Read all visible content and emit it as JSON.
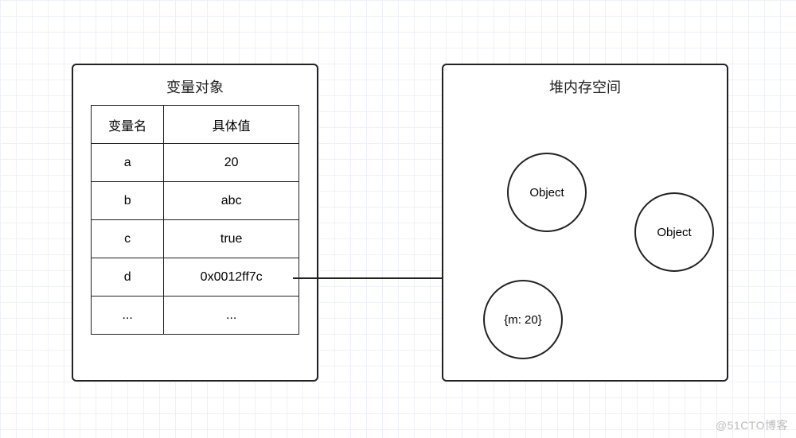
{
  "left_panel": {
    "title": "变量对象",
    "header": {
      "name": "变量名",
      "value": "具体值"
    },
    "rows": [
      {
        "name": "a",
        "value": "20"
      },
      {
        "name": "b",
        "value": "abc"
      },
      {
        "name": "c",
        "value": "true"
      },
      {
        "name": "d",
        "value": "0x0012ff7c"
      },
      {
        "name": "...",
        "value": "..."
      }
    ]
  },
  "right_panel": {
    "title": "堆内存空间",
    "objects": [
      {
        "label": "Object"
      },
      {
        "label": "Object"
      },
      {
        "label": "{m: 20}"
      }
    ]
  },
  "arrow": {
    "from": "d",
    "to_index": 2
  },
  "watermark": "@51CTO博客"
}
